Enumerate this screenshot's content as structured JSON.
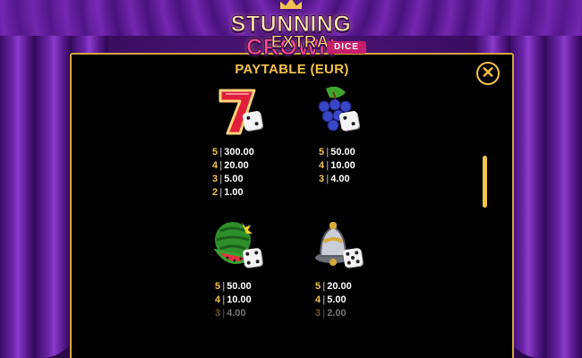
{
  "game": {
    "logo_line1_word1": "STUNNING",
    "logo_line1_word2": "CROWN",
    "logo_line2": "EXTRA",
    "logo_badge": "DICE"
  },
  "paytable": {
    "title": "PAYTABLE (EUR)",
    "close_icon": "close-x-icon",
    "symbols": [
      {
        "name": "seven",
        "icon": "seven-dice-icon",
        "pays": [
          {
            "count": "5",
            "value": "300.00"
          },
          {
            "count": "4",
            "value": "20.00"
          },
          {
            "count": "3",
            "value": "5.00"
          },
          {
            "count": "2",
            "value": "1.00"
          }
        ]
      },
      {
        "name": "grapes",
        "icon": "grapes-dice-icon",
        "pays": [
          {
            "count": "5",
            "value": "50.00"
          },
          {
            "count": "4",
            "value": "10.00"
          },
          {
            "count": "3",
            "value": "4.00"
          }
        ]
      },
      {
        "name": "watermelon",
        "icon": "watermelon-dice-icon",
        "pays": [
          {
            "count": "5",
            "value": "50.00"
          },
          {
            "count": "4",
            "value": "10.00"
          },
          {
            "count": "3",
            "value": "4.00"
          }
        ]
      },
      {
        "name": "bell",
        "icon": "bell-dice-icon",
        "pays": [
          {
            "count": "5",
            "value": "20.00"
          },
          {
            "count": "4",
            "value": "5.00"
          },
          {
            "count": "3",
            "value": "2.00"
          }
        ]
      }
    ]
  },
  "colors": {
    "accent": "#f5c24a",
    "panel_bg": "#000000",
    "background": "#3a0d60"
  }
}
